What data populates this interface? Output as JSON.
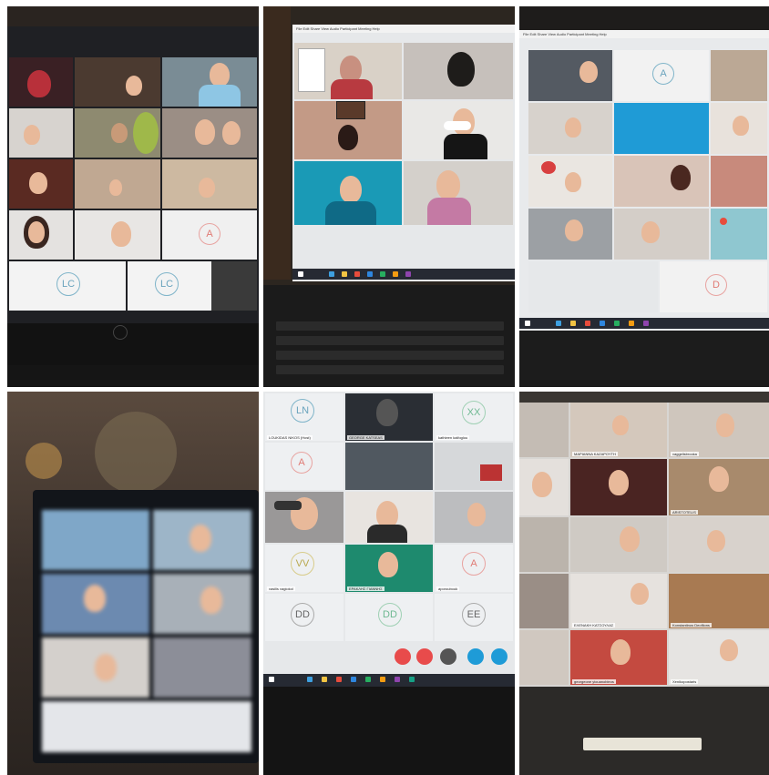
{
  "panels": [
    {
      "id": "panel-top-left",
      "avatars": [
        "A",
        "LC",
        "LC"
      ]
    },
    {
      "id": "panel-top-middle",
      "menu": "File  Edit  Share  View  Audio  Participant  Meeting  Help"
    },
    {
      "id": "panel-top-right",
      "menu": "File  Edit  Share  View  Audio  Participant  Meeting  Help",
      "avatars": [
        "A",
        "D"
      ]
    },
    {
      "id": "panel-bottom-left"
    },
    {
      "id": "panel-bottom-middle",
      "avatars": [
        "LN",
        "XX",
        "A",
        "VV",
        "A",
        "DD",
        "DD",
        "EE"
      ],
      "names": [
        "LOUKIDAS NIKOS (Host)",
        "GEORGE KATSEAS",
        "kathleen kalfoglou",
        "ΕΡΑΚΛΗΣ ΓΙΑΝΝΗΣ",
        "aporoubouk",
        "vasilis vagiokol"
      ]
    },
    {
      "id": "panel-bottom-right",
      "names": [
        "ΜΑΡΙΑΝΝΑ ΚΑΖΑΡΟΥΤΗ",
        "vaggelisbrooka",
        "ARISTOTELIS",
        "ΕΛΕΝΑΚΗ ΚΑΤΣΟΥΛΑΣ",
        "Konstantinos Deoflions",
        "Xenikopostaris",
        "georgeone yiouanobleos"
      ]
    }
  ],
  "colors": {
    "screen_bg": "#d9dde2",
    "zoom_tile_bg": "#e9ecef",
    "taskbar": "#262a33",
    "control_red": "#e84b4b",
    "control_blue": "#1e9bd7"
  }
}
